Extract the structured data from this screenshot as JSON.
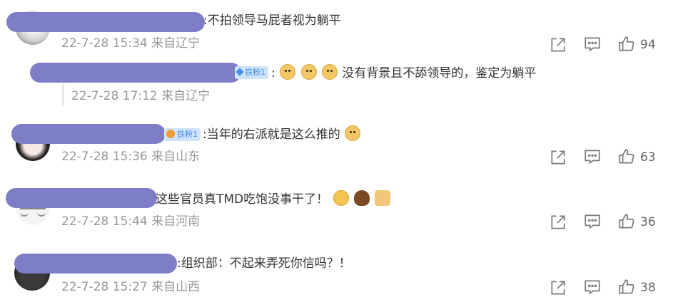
{
  "comments": [
    {
      "text": ":不拍领导马屁者视为躺平",
      "meta": "22-7-28 15:34 来自辽宁",
      "likes": "94"
    },
    {
      "text": "没有背景且不舔领导的，鉴定为躺平",
      "prefix": ":",
      "badge": "铁粉1",
      "meta": "22-7-28 17:12 来自辽宁",
      "is_reply": true
    },
    {
      "text": ":当年的右派就是这么推的",
      "badge": "铁粉1",
      "meta": "22-7-28 15:36 来自山东",
      "likes": "63"
    },
    {
      "text": "这些官员真TMD吃饱没事干了！",
      "meta": "22-7-28 15:44 来自河南",
      "likes": "36"
    },
    {
      "text": ":组织部：不起来弄死你信吗？！",
      "meta": "22-7-28 15:27 来自山西",
      "likes": "38"
    }
  ],
  "icons": {
    "share": "share-icon",
    "comment": "comment-icon",
    "like": "thumbs-up-icon"
  },
  "colors": {
    "redaction": "#7d7ec6",
    "meta_text": "#999999",
    "badge_bg": "#cfe3fb",
    "badge_text": "#4a8fe6"
  }
}
